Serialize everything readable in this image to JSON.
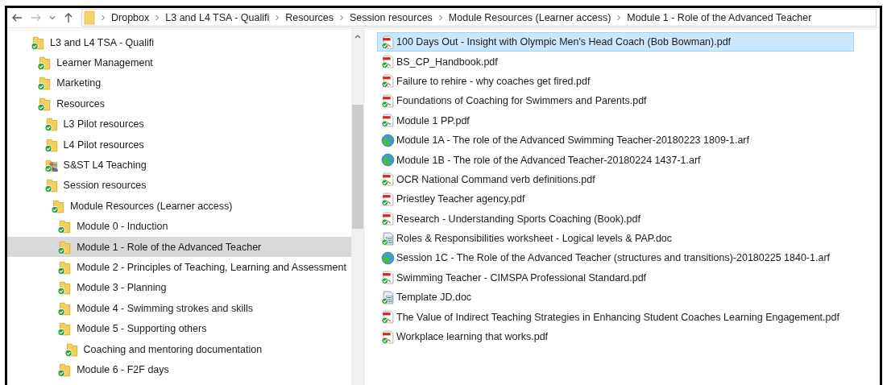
{
  "breadcrumb": [
    "Dropbox",
    "L3 and L4 TSA - Qualifi",
    "Resources",
    "Session resources",
    "Module Resources (Learner access)",
    "Module 1 - Role of the Advanced Teacher"
  ],
  "navigation_tree": [
    {
      "label": "L3 and L4 TSA - Qualifi",
      "kind": "folder",
      "selected": false,
      "children": [
        {
          "label": "Learner Management",
          "kind": "folder",
          "selected": false
        },
        {
          "label": "Marketing",
          "kind": "folder",
          "selected": false
        },
        {
          "label": "Resources",
          "kind": "folder",
          "selected": false,
          "children": [
            {
              "label": "L3 Pilot resources",
              "kind": "folder",
              "selected": false
            },
            {
              "label": "L4 Pilot resources",
              "kind": "folder",
              "selected": false
            },
            {
              "label": "S&ST L4 Teaching",
              "kind": "shared",
              "selected": false
            },
            {
              "label": "Session resources",
              "kind": "folder",
              "selected": false,
              "children": [
                {
                  "label": "Module Resources (Learner access)",
                  "kind": "folder",
                  "selected": false,
                  "children": [
                    {
                      "label": "Module 0 - Induction",
                      "kind": "folder",
                      "selected": false
                    },
                    {
                      "label": "Module 1 - Role of the Advanced Teacher",
                      "kind": "folder",
                      "selected": true
                    },
                    {
                      "label": "Module 2 - Principles of Teaching, Learning and Assessment",
                      "kind": "folder",
                      "selected": false
                    },
                    {
                      "label": "Module 3 - Planning",
                      "kind": "folder",
                      "selected": false
                    },
                    {
                      "label": "Module 4 - Swimming strokes and skills",
                      "kind": "folder",
                      "selected": false
                    },
                    {
                      "label": "Module 5 - Supporting others",
                      "kind": "folder",
                      "selected": false,
                      "children": [
                        {
                          "label": "Coaching and mentoring documentation",
                          "kind": "folder",
                          "selected": false
                        }
                      ]
                    },
                    {
                      "label": "Module 6 - F2F days",
                      "kind": "folder",
                      "selected": false
                    }
                  ]
                }
              ]
            }
          ]
        }
      ]
    }
  ],
  "files": [
    {
      "name": "100 Days Out - Insight with Olympic Men's Head Coach (Bob Bowman).pdf",
      "kind": "pdf",
      "selected": true
    },
    {
      "name": "BS_CP_Handbook.pdf",
      "kind": "pdf",
      "selected": false
    },
    {
      "name": "Failure to rehire - why coaches get fired.pdf",
      "kind": "pdf",
      "selected": false
    },
    {
      "name": "Foundations of Coaching for Swimmers and Parents.pdf",
      "kind": "pdf",
      "selected": false
    },
    {
      "name": "Module 1 PP.pdf",
      "kind": "pdf",
      "selected": false
    },
    {
      "name": "Module 1A - The role of the Advanced Swimming Teacher-20180223 1809-1.arf",
      "kind": "arf",
      "selected": false
    },
    {
      "name": "Module 1B - The role of the Advanced Teacher-20180224 1437-1.arf",
      "kind": "arf",
      "selected": false
    },
    {
      "name": "OCR National Command verb definitions.pdf",
      "kind": "pdf",
      "selected": false
    },
    {
      "name": "Priestley Teacher agency.pdf",
      "kind": "pdf",
      "selected": false
    },
    {
      "name": "Research - Understanding Sports Coaching (Book).pdf",
      "kind": "pdf",
      "selected": false
    },
    {
      "name": "Roles & Responsibilities worksheet - Logical levels & PAP.doc",
      "kind": "doc",
      "selected": false
    },
    {
      "name": "Session 1C - The Role of the Advanced Teacher (structures and transitions)-20180225 1840-1.arf",
      "kind": "arf",
      "selected": false
    },
    {
      "name": "Swimming Teacher - CIMSPA Professional Standard.pdf",
      "kind": "pdf",
      "selected": false
    },
    {
      "name": "Template JD.doc",
      "kind": "doc",
      "selected": false
    },
    {
      "name": "The Value of Indirect Teaching Strategies in Enhancing Student Coaches Learning Engagement.pdf",
      "kind": "pdf",
      "selected": false
    },
    {
      "name": "Workplace learning that works.pdf",
      "kind": "pdf",
      "selected": false
    }
  ]
}
